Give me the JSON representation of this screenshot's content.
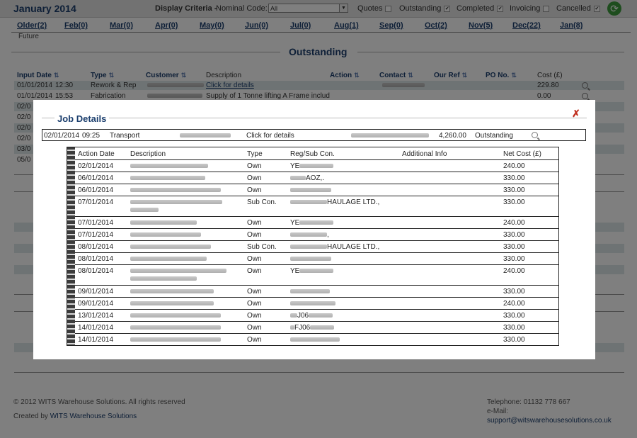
{
  "header": {
    "title": "January 2014",
    "criteria_label": "Display Criteria -",
    "nominal_label": "Nominal Code:",
    "nominal_value": "All",
    "filters": [
      {
        "label": "Quotes",
        "checked": false
      },
      {
        "label": "Outstanding",
        "checked": true
      },
      {
        "label": "Completed",
        "checked": true
      },
      {
        "label": "Invoicing",
        "checked": false
      },
      {
        "label": "Cancelled",
        "checked": true
      }
    ]
  },
  "months": [
    "Older(2)",
    "Feb(0)",
    "Mar(0)",
    "Apr(0)",
    "May(0)",
    "Jun(0)",
    "Jul(0)",
    "Aug(1)",
    "Sep(0)",
    "Oct(2)",
    "Nov(5)",
    "Dec(22)",
    "Jan(8)"
  ],
  "future_label": "Future",
  "section_title": "Outstanding",
  "columns": {
    "input_date": "Input Date",
    "type": "Type",
    "customer": "Customer",
    "description": "Description",
    "action": "Action",
    "contact": "Contact",
    "our_ref": "Our Ref",
    "po_no": "PO No.",
    "cost": "Cost (£)"
  },
  "rows": [
    {
      "date": "01/01/2014",
      "time": "12:30",
      "type": "Rework & Rep",
      "description": "Click for details",
      "cost": "229.80"
    },
    {
      "date": "01/01/2014",
      "time": "15:53",
      "type": "Fabrication",
      "description": "Supply of 1 Tonne lifting A Frame includ",
      "cost": "0.00"
    }
  ],
  "partial_dates": [
    "02/0",
    "02/0",
    "02/0",
    "02/0",
    "03/0",
    "05/0"
  ],
  "footer": {
    "copyright": "© 2012 WITS Warehouse Solutions. All rights reserved",
    "created_by": "Created by",
    "created_link": "WITS Warehouse Solutions",
    "telephone": "Telephone: 01132 778 667",
    "email_label": "e-Mail:",
    "email": "support@witswarehousesolutions.co.uk"
  },
  "modal": {
    "title": "Job Details",
    "job": {
      "date": "02/01/2014",
      "time": "09:25",
      "type": "Transport",
      "description": "Click for details",
      "cost": "4,260.00",
      "status": "Outstanding"
    },
    "columns": {
      "action_date": "Action Date",
      "description": "Description",
      "type": "Type",
      "reg": "Reg/Sub Con.",
      "info": "Additional Info",
      "net_cost": "Net Cost (£)"
    },
    "rows": [
      {
        "date": "02/01/2014",
        "type": "Own",
        "reg": "YE",
        "cost": "240.00"
      },
      {
        "date": "06/01/2014",
        "type": "Own",
        "reg": "AOZ,.",
        "cost": "330.00"
      },
      {
        "date": "06/01/2014",
        "type": "Own",
        "reg": "",
        "cost": "330.00"
      },
      {
        "date": "07/01/2014",
        "type": "Sub Con.",
        "reg": "HAULAGE LTD.,",
        "cost": "330.00"
      },
      {
        "date": "07/01/2014",
        "type": "Own",
        "reg": "YE",
        "cost": "240.00"
      },
      {
        "date": "07/01/2014",
        "type": "Own",
        "reg": ",",
        "cost": "330.00"
      },
      {
        "date": "08/01/2014",
        "type": "Sub Con.",
        "reg": "HAULAGE LTD.,",
        "cost": "330.00"
      },
      {
        "date": "08/01/2014",
        "type": "Own",
        "reg": "",
        "cost": "330.00"
      },
      {
        "date": "08/01/2014",
        "type": "Own",
        "reg": "YE",
        "cost": "240.00"
      },
      {
        "date": "09/01/2014",
        "type": "Own",
        "reg": "",
        "cost": "330.00"
      },
      {
        "date": "09/01/2014",
        "type": "Own",
        "reg": "",
        "cost": "240.00"
      },
      {
        "date": "13/01/2014",
        "type": "Own",
        "reg": "J06",
        "cost": "330.00"
      },
      {
        "date": "14/01/2014",
        "type": "Own",
        "reg": "FJ06",
        "cost": "330.00"
      },
      {
        "date": "14/01/2014",
        "type": "Own",
        "reg": "",
        "cost": "330.00"
      }
    ]
  }
}
